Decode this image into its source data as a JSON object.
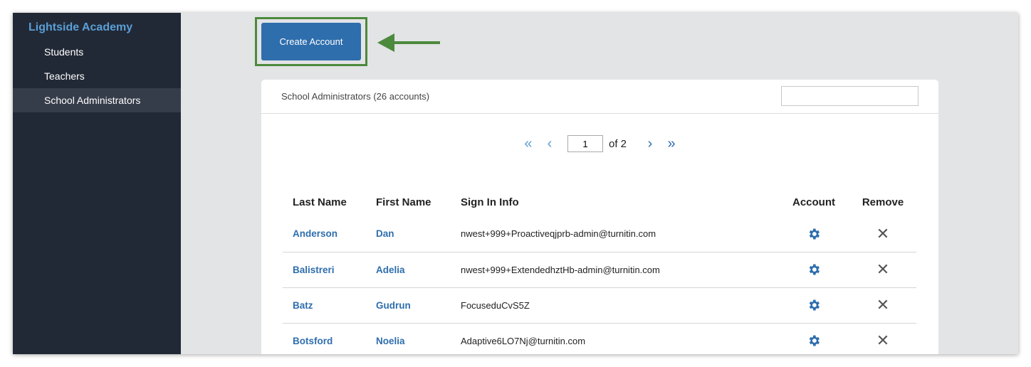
{
  "sidebar": {
    "brand": "Lightside Academy",
    "items": [
      {
        "label": "Students"
      },
      {
        "label": "Teachers"
      },
      {
        "label": "School Administrators"
      }
    ]
  },
  "toolbar": {
    "create_label": "Create Account"
  },
  "card": {
    "title": "School Administrators (26 accounts)",
    "search_value": ""
  },
  "pager": {
    "page": "1",
    "of_label": "of 2",
    "first_icon": "«",
    "prev_icon": "‹",
    "next_icon": "›",
    "last_icon": "»"
  },
  "table": {
    "headers": [
      "Last Name",
      "First Name",
      "Sign In Info",
      "Account",
      "Remove"
    ],
    "rows": [
      {
        "last": "Anderson",
        "first": "Dan",
        "signin": "nwest+999+Proactiveqjprb-admin@turnitin.com"
      },
      {
        "last": "Balistreri",
        "first": "Adelia",
        "signin": "nwest+999+ExtendedhztHb-admin@turnitin.com"
      },
      {
        "last": "Batz",
        "first": "Gudrun",
        "signin": "FocuseduCvS5Z"
      },
      {
        "last": "Botsford",
        "first": "Noelia",
        "signin": "Adaptive6LO7Nj@turnitin.com"
      }
    ]
  },
  "colors": {
    "accent": "#2e6ead",
    "highlight": "#4c8a3d",
    "sidebar": "#222936"
  }
}
